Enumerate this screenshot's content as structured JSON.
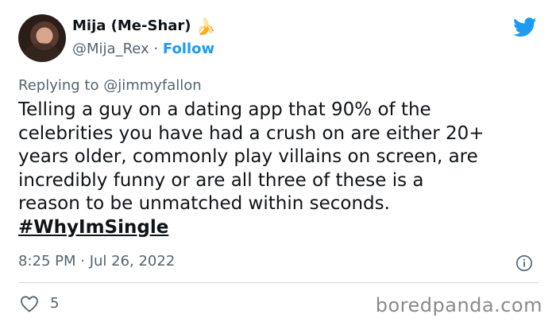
{
  "tweet": {
    "author_name": "Mija (Me-Shar)",
    "author_emoji": "🍌",
    "handle": "@Mija_Rex",
    "separator": "·",
    "follow_label": "Follow",
    "replying_to": "Replying to @jimmyfallon",
    "body_lines": [
      "Telling a guy on a dating app that 90% of the",
      "celebrities you have had a crush on are either 20+",
      "years older, commonly play villains on screen, are",
      "incredibly funny or are all three of these is a",
      "reason to be unmatched within seconds."
    ],
    "hashtag": "#WhyImSingle",
    "timestamp": "8:25 PM · Jul 26, 2022",
    "like_count": "5"
  },
  "icons": {
    "logo": "twitter-bird-icon",
    "info": "info-icon",
    "like": "heart-icon"
  },
  "colors": {
    "accent": "#1d9bf0",
    "text": "#0f1419",
    "secondary": "#536471"
  },
  "watermark": "boredpanda.com"
}
